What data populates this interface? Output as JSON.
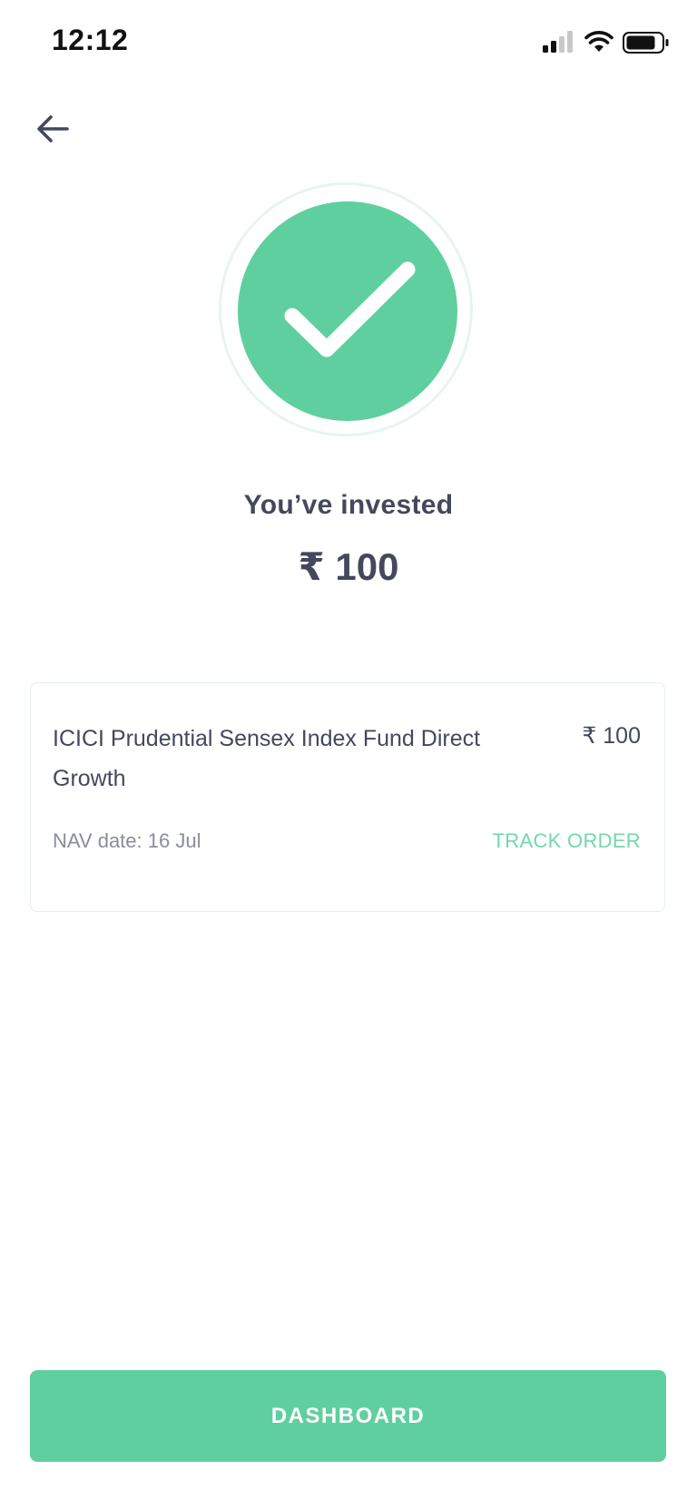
{
  "status_bar": {
    "time": "12:12",
    "icons": [
      "cellular-signal-icon",
      "wifi-icon",
      "battery-icon"
    ]
  },
  "header": {
    "back_icon": "arrow-left-icon"
  },
  "success": {
    "icon": "checkmark-icon",
    "accent_color": "#5fcf9f",
    "label": "You’ve invested",
    "amount": "₹ 100"
  },
  "order": {
    "fund_name": "ICICI Prudential Sensex Index Fund Direct Growth",
    "amount": "₹ 100",
    "nav_date": "NAV date: 16 Jul",
    "track_label": "TRACK ORDER"
  },
  "footer": {
    "button_label": "DASHBOARD"
  }
}
